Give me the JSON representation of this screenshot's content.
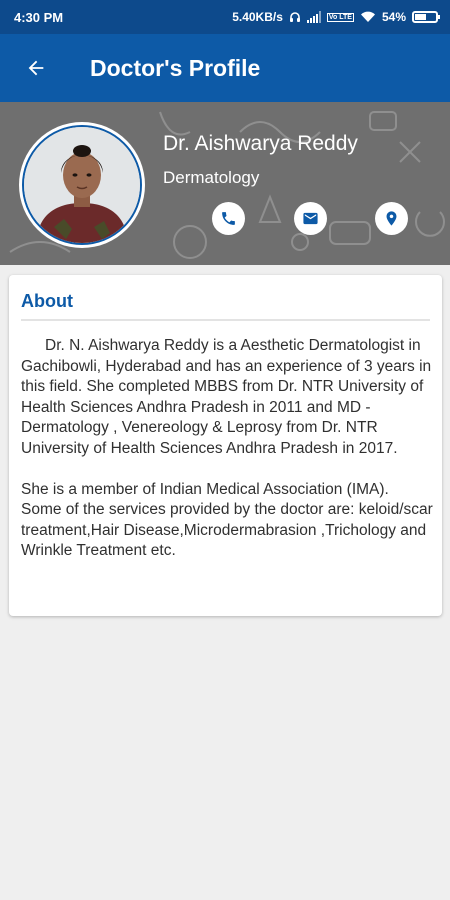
{
  "status_bar": {
    "time": "4:30 PM",
    "network_speed": "5.40KB/s",
    "volte_label": "Vo LTE",
    "battery_percent": "54%",
    "battery_level": 0.54
  },
  "app_bar": {
    "title": "Doctor's Profile",
    "back_icon": "arrow-back-icon"
  },
  "profile": {
    "name": "Dr. Aishwarya Reddy",
    "speciality": "Dermatology",
    "actions": [
      {
        "icon": "phone-icon"
      },
      {
        "icon": "email-icon"
      },
      {
        "icon": "location-pin-icon"
      }
    ]
  },
  "about": {
    "title": "About",
    "paragraphs": [
      "Dr. N. Aishwarya Reddy is a Aesthetic Dermatologist in Gachibowli, Hyderabad and has an experience of 3 years in this field. She completed MBBS from Dr. NTR University of Health Sciences Andhra Pradesh in 2011 and MD - Dermatology , Venereology & Leprosy from Dr. NTR University of Health Sciences Andhra Pradesh in 2017.",
      "She is a member of Indian Medical Association (IMA). Some of the services provided by the doctor are: keloid/scar treatment,Hair Disease,Microdermabrasion ,Trichology and Wrinkle Treatment etc."
    ]
  },
  "colors": {
    "status_bar": "#0d4a8c",
    "app_bar": "#0d5aa7",
    "header_bg": "#6f6f6f",
    "accent": "#0d5aa7",
    "page_bg": "#efefef"
  }
}
